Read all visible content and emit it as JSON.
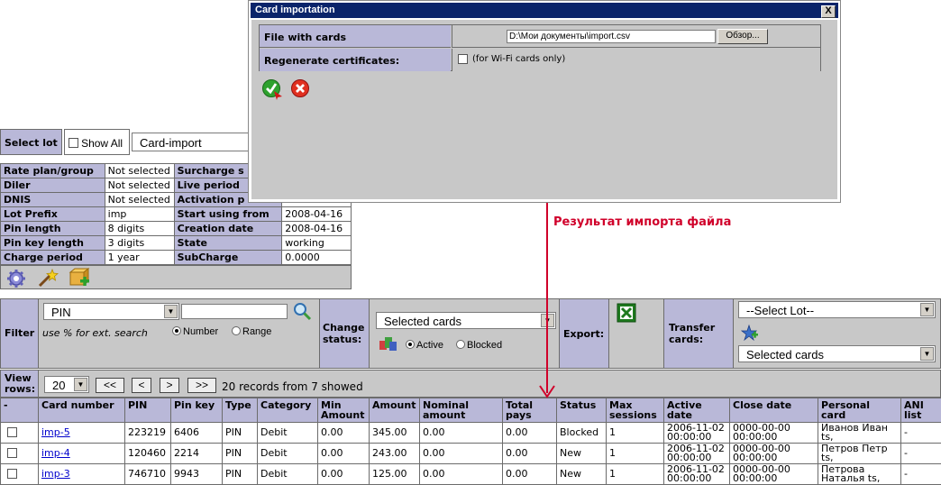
{
  "select_lot": {
    "label": "Select lot",
    "show_all_label": "Show All",
    "selected_lot": "Card-import"
  },
  "lot_info": {
    "rows": [
      {
        "k1": "Rate plan/group",
        "v1": "Not selected",
        "k2": "Surcharge s",
        "v2": ""
      },
      {
        "k1": "Diler",
        "v1": "Not selected",
        "k2": "Live period",
        "v2": ""
      },
      {
        "k1": "DNIS",
        "v1": "Not selected",
        "k2": "Activation p",
        "v2": ""
      },
      {
        "k1": "Lot Prefix",
        "v1": "imp",
        "k2": "Start using from",
        "v2": "2008-04-16"
      },
      {
        "k1": "Pin length",
        "v1": "8 digits",
        "k2": "Creation date",
        "v2": "2008-04-16"
      },
      {
        "k1": "Pin key length",
        "v1": "3 digits",
        "k2": "State",
        "v2": "working"
      },
      {
        "k1": "Charge period",
        "v1": "1 year",
        "k2": "SubCharge",
        "v2": "0.0000"
      }
    ]
  },
  "filter": {
    "label": "Filter",
    "field_select": "PIN",
    "search_value": "",
    "hint": "use % for ext. search",
    "mode_number": "Number",
    "mode_range": "Range",
    "change_status_label": "Change status:",
    "status_select": "Selected cards",
    "status_active": "Active",
    "status_blocked": "Blocked",
    "export_label": "Export:",
    "transfer_label": "Transfer cards:",
    "lot_select": "--Select Lot--",
    "transfer_select": "Selected cards"
  },
  "view_rows": {
    "label": "View rows:",
    "value": "20",
    "first": "<<",
    "prev": "<",
    "next": ">",
    "last": ">>",
    "summary": "20 records from 7 showed"
  },
  "table": {
    "headers": [
      "-",
      "Card number",
      "PIN",
      "Pin key",
      "Type",
      "Category",
      "Min Amount",
      "Amount",
      "Nominal amount",
      "Total pays",
      "Status",
      "Max sessions",
      "Active date",
      "Close date",
      "Personal card",
      "ANI list"
    ],
    "rows": [
      {
        "card": "imp-5",
        "pin": "223219",
        "pinkey": "6406",
        "type": "PIN",
        "category": "Debit",
        "min": "0.00",
        "amount": "345.00",
        "nominal": "0.00",
        "total": "0.00",
        "status": "Blocked",
        "max": "1",
        "active": "2006-11-02 00:00:00",
        "close": "0000-00-00 00:00:00",
        "personal": "Иванов Иван ts,",
        "ani": "-"
      },
      {
        "card": "imp-4",
        "pin": "120460",
        "pinkey": "2214",
        "type": "PIN",
        "category": "Debit",
        "min": "0.00",
        "amount": "243.00",
        "nominal": "0.00",
        "total": "0.00",
        "status": "New",
        "max": "1",
        "active": "2006-11-02 00:00:00",
        "close": "0000-00-00 00:00:00",
        "personal": "Петров Петр ts,",
        "ani": "-"
      },
      {
        "card": "imp-3",
        "pin": "746710",
        "pinkey": "9943",
        "type": "PIN",
        "category": "Debit",
        "min": "0.00",
        "amount": "125.00",
        "nominal": "0.00",
        "total": "0.00",
        "status": "New",
        "max": "1",
        "active": "2006-11-02 00:00:00",
        "close": "0000-00-00 00:00:00",
        "personal": "Петрова Наталья ts,",
        "ani": "-"
      }
    ]
  },
  "dialog": {
    "title": "Card importation",
    "close": "X",
    "file_label": "File with cards",
    "file_value": "D:\\Мои документы\\import.csv",
    "browse_label": "Обзор...",
    "regen_label": "Regenerate certificates:",
    "regen_note": "(for Wi-Fi cards only)"
  },
  "annotation": "Результат импорта файла",
  "colors": {
    "header_bg": "#b9b8d8",
    "panel_bg": "#c8c8c8",
    "title_bar": "#0a246a",
    "annotation": "#d0002a"
  }
}
